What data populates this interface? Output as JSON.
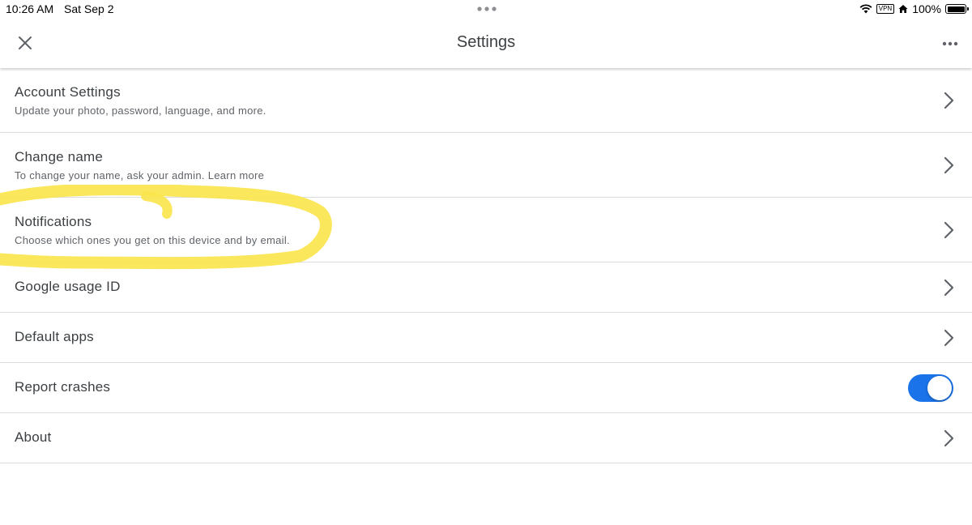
{
  "status_bar": {
    "time": "10:26 AM",
    "date": "Sat Sep 2",
    "vpn_label": "VPN",
    "battery": "100%",
    "icons": [
      "wifi-icon",
      "vpn-icon",
      "home-icon",
      "battery-icon"
    ]
  },
  "app_bar": {
    "title": "Settings",
    "close_icon": "close-icon",
    "more_icon": "more-horizontal-icon"
  },
  "settings": [
    {
      "title": "Account Settings",
      "subtitle": "Update your photo, password, language, and more."
    },
    {
      "title": "Change name",
      "subtitle": "To change your name, ask your admin. Learn more"
    },
    {
      "title": "Notifications",
      "subtitle": "Choose which ones you get on this device and by email."
    },
    {
      "title": "Google usage ID"
    },
    {
      "title": "Default apps"
    },
    {
      "title": "Report crashes",
      "toggle_on": true
    },
    {
      "title": "About"
    }
  ],
  "colors": {
    "accent": "#1a73e8",
    "highlight": "#f9e44a",
    "divider": "#dadce0"
  }
}
